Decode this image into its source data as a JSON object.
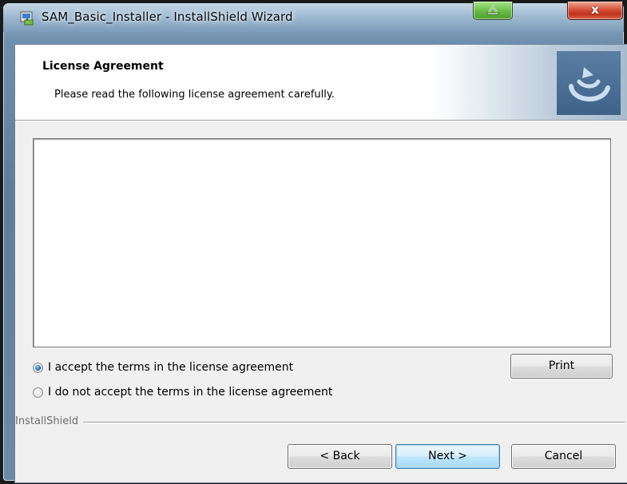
{
  "window": {
    "title": "SAM_Basic_Installer - InstallShield Wizard",
    "close_glyph": "x",
    "icons": [
      "installer-icon",
      "restore-icon",
      "close-icon"
    ]
  },
  "header": {
    "title": "License Agreement",
    "subtitle": "Please read the following license agreement carefully.",
    "logo": "installshield-logo-icon"
  },
  "license_text": "",
  "options": {
    "accept": {
      "label": "I accept the terms in the license agreement",
      "checked": true
    },
    "decline": {
      "label": "I do not accept the terms in the license agreement",
      "checked": false
    }
  },
  "buttons": {
    "print": "Print",
    "back": "< Back",
    "next": "Next >",
    "cancel": "Cancel"
  },
  "footer": {
    "group_label": "InstallShield"
  },
  "colors": {
    "accent": "#3c7fb1",
    "close_button": "#c1331c",
    "minimize_button": "#6cc04a",
    "logo_bg": "#4a6f95"
  }
}
